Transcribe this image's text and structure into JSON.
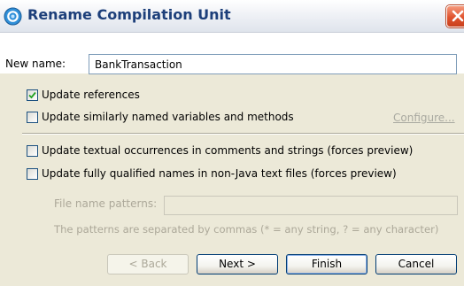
{
  "dialog": {
    "title": "Rename Compilation Unit",
    "close_icon": "close-x-icon",
    "title_icon": "eclipse-refactor-icon"
  },
  "name_field": {
    "label": "New name:",
    "value": "BankTransaction"
  },
  "options": {
    "update_references": {
      "label": "Update references",
      "checked": true
    },
    "update_similar": {
      "label": "Update similarly named variables and methods",
      "checked": false
    },
    "configure_link": "Configure...",
    "update_textual": {
      "label": "Update textual occurrences in comments and strings (forces preview)",
      "checked": false
    },
    "update_qualified": {
      "label": "Update fully qualified names in non-Java text files (forces preview)",
      "checked": false
    }
  },
  "file_patterns": {
    "label": "File name patterns:",
    "value": "",
    "hint": "The patterns are separated by commas (* = any string, ? = any character)"
  },
  "buttons": {
    "back": "< Back",
    "next": "Next >",
    "finish": "Finish",
    "cancel": "Cancel"
  },
  "colors": {
    "title_text": "#1d3f7a",
    "dialog_bg": "#ece9d8",
    "disabled_text": "#aca899",
    "close_button": "#e0532e"
  }
}
